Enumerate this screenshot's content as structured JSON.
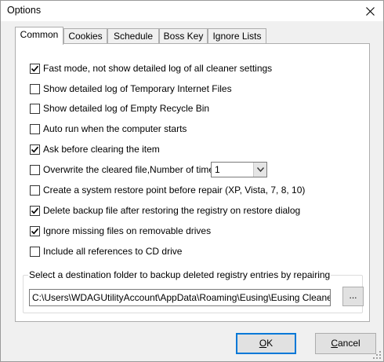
{
  "window": {
    "title": "Options",
    "close_label": "✕"
  },
  "tabs": [
    {
      "label": "Common",
      "active": true
    },
    {
      "label": "Cookies",
      "active": false
    },
    {
      "label": "Schedule",
      "active": false
    },
    {
      "label": "Boss Key",
      "active": false
    },
    {
      "label": "Ignore Lists",
      "active": false
    }
  ],
  "options": [
    {
      "label": "Fast mode, not show detailed log of all cleaner settings",
      "checked": true
    },
    {
      "label": "Show detailed log of Temporary Internet Files",
      "checked": false
    },
    {
      "label": "Show detailed log of Empty Recycle Bin",
      "checked": false
    },
    {
      "label": "Auto run when the computer starts",
      "checked": false
    },
    {
      "label": "Ask before clearing the item",
      "checked": true
    },
    {
      "label": "Overwrite the cleared file,Number of times",
      "checked": false
    },
    {
      "label": "Create a system restore point before repair (XP, Vista, 7, 8, 10)",
      "checked": false
    },
    {
      "label": "Delete backup file after restoring the registry on restore dialog",
      "checked": true
    },
    {
      "label": "Ignore missing files on removable drives",
      "checked": true
    },
    {
      "label": "Include all references to CD drive",
      "checked": false
    }
  ],
  "overwrite_count": {
    "value": "1"
  },
  "backup_folder": {
    "label": "Select a destination folder to backup deleted registry entries by repairing",
    "path": "C:\\Users\\WDAGUtilityAccount\\AppData\\Roaming\\Eusing\\Eusing Cleaner\\Ba",
    "browse_label": "..."
  },
  "buttons": {
    "ok_mnemonic": "O",
    "ok_rest": "K",
    "cancel_mnemonic": "C",
    "cancel_rest": "ancel"
  },
  "colors": {
    "focus_border": "#0078d7",
    "panel_bg": "#ffffff",
    "dialog_bg": "#f0f0f0"
  }
}
